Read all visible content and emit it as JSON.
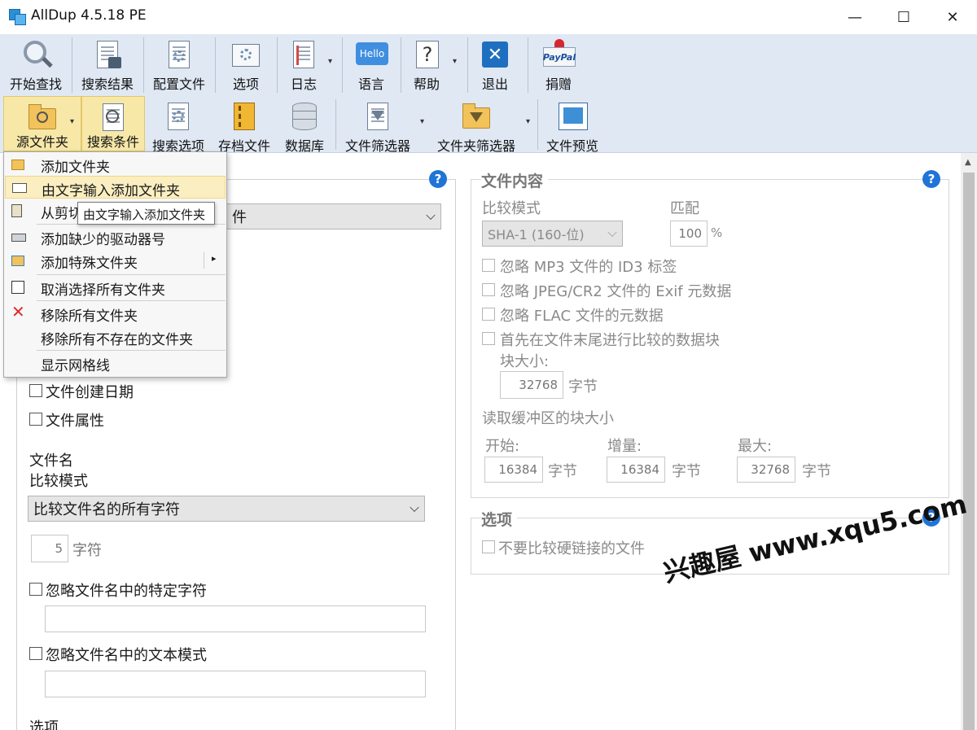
{
  "window": {
    "title": "AllDup 4.5.18 PE",
    "min_label": "—",
    "max_label": "☐",
    "close_label": "✕"
  },
  "toolbar_main": [
    {
      "id": "start",
      "label": "开始查找",
      "icon": "magnifier-icon"
    },
    {
      "id": "results",
      "label": "搜索结果",
      "icon": "results-icon"
    },
    {
      "id": "profile",
      "label": "配置文件",
      "icon": "profile-icon"
    },
    {
      "id": "options",
      "label": "选项",
      "icon": "options-icon"
    },
    {
      "id": "log",
      "label": "日志",
      "icon": "log-icon"
    },
    {
      "id": "language",
      "label": "语言",
      "icon": "hello-icon",
      "icon_text": "Hello"
    },
    {
      "id": "help",
      "label": "帮助",
      "icon": "question-icon",
      "icon_text": "?"
    },
    {
      "id": "exit",
      "label": "退出",
      "icon": "exit-icon",
      "icon_text": "✕"
    },
    {
      "id": "donate",
      "label": "捐赠",
      "icon": "paypal-icon",
      "icon_text": "PayPal"
    }
  ],
  "toolbar_sub": [
    {
      "id": "source",
      "label": "源文件夹"
    },
    {
      "id": "criteria",
      "label": "搜索条件"
    },
    {
      "id": "search_opts",
      "label": "搜索选项"
    },
    {
      "id": "archive",
      "label": "存档文件"
    },
    {
      "id": "database",
      "label": "数据库"
    },
    {
      "id": "file_filter",
      "label": "文件筛选器"
    },
    {
      "id": "folder_filter",
      "label": "文件夹筛选器"
    },
    {
      "id": "preview",
      "label": "文件预览"
    }
  ],
  "menu": {
    "items": [
      {
        "label": "添加文件夹",
        "icon": "add-folder-icon"
      },
      {
        "label": "由文字输入添加文件夹",
        "icon": "text-input-folder-icon"
      },
      {
        "label": "从剪切",
        "icon": "clipboard-icon"
      },
      {
        "label": "添加缺少的驱动器号",
        "icon": "drive-icon"
      },
      {
        "label": "添加特殊文件夹",
        "icon": "special-folder-icon",
        "submenu": "▸"
      },
      {
        "label": "取消选择所有文件夹",
        "icon": "checkbox-icon"
      },
      {
        "label": "移除所有文件夹",
        "icon": "remove-icon"
      },
      {
        "label": "移除所有不存在的文件夹",
        "icon": ""
      },
      {
        "label": "显示网格线",
        "icon": ""
      }
    ],
    "tooltip": "由文字输入添加文件夹"
  },
  "left_panel": {
    "combo_partial": "件",
    "cb_created": "文件创建日期",
    "cb_attr": "文件属性",
    "filename_label": "文件名",
    "compare_mode_label": "比较模式",
    "compare_mode_value": "比较文件名的所有字符",
    "chars_value": "5",
    "chars_unit": "字符",
    "cb_ignore_chars": "忽略文件名中的特定字符",
    "cb_ignore_pattern": "忽略文件名中的文本模式",
    "options_label": "选项"
  },
  "content_group": {
    "title": "文件内容",
    "compare_mode_label": "比较模式",
    "match_label": "匹配",
    "hash_value": "SHA-1 (160-位)",
    "match_value": "100",
    "match_unit": "%",
    "cb_mp3": "忽略 MP3 文件的 ID3 标签",
    "cb_jpeg": "忽略 JPEG/CR2 文件的 Exif 元数据",
    "cb_flac": "忽略 FLAC 文件的元数据",
    "cb_tail": "首先在文件末尾进行比较的数据块",
    "block_size_label": "块大小:",
    "block_size_value": "32768",
    "byte_unit": "字节",
    "buffer_label": "读取缓冲区的块大小",
    "start_label": "开始:",
    "step_label": "增量:",
    "max_label": "最大:",
    "start_value": "16384",
    "step_value": "16384",
    "max_value": "32768"
  },
  "options_group": {
    "title": "选项",
    "cb_hardlink": "不要比较硬链接的文件"
  },
  "watermark": "兴趣屋 www.xqu5.com",
  "colors": {
    "toolbar_bg": "#dfe8f3",
    "help_blue": "#1f74d6",
    "menu_highlight": "#fbeec0"
  }
}
